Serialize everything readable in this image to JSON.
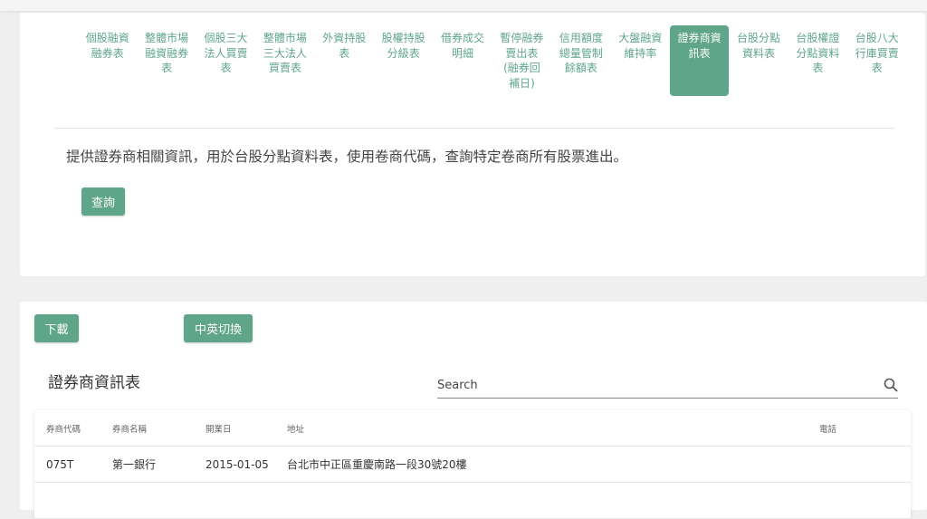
{
  "tabs": [
    "個股融資融券表",
    "整體市場融資融券表",
    "個股三大法人買賣表",
    "整體市場三大法人買賣表",
    "外資持股表",
    "股權持股分級表",
    "借券成交明細",
    "暫停融券賣出表(融券回補日)",
    "信用額度總量管制餘額表",
    "大盤融資維持率",
    "證券商資訊表",
    "台股分點資料表",
    "台股權證分點資料表",
    "台股八大行庫買賣表"
  ],
  "active_tab": "證券商資訊表",
  "description": "提供證券商相關資訊，用於台股分點資料表，使用卷商代碼，查詢特定卷商所有股票進出。",
  "query_label": "查詢",
  "download_label": "下載",
  "lang_toggle_label": "中英切換",
  "table_title": "證券商資訊表",
  "search_placeholder": "Search",
  "columns": [
    "券商代碼",
    "券商名稱",
    "開業日",
    "地址",
    "電話"
  ],
  "rows": [
    [
      "075T",
      "第一銀行",
      "2015-01-05",
      "台北市中正區重慶南路一段30號20樓",
      ""
    ]
  ],
  "accent": "#5fa58a"
}
